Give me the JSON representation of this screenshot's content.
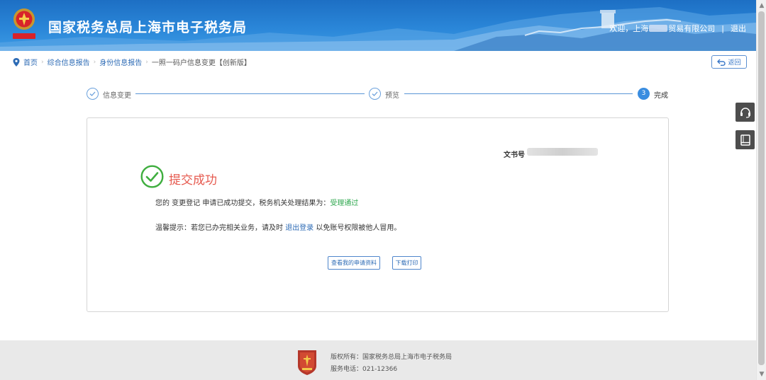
{
  "header": {
    "emblem_text": "中国税务",
    "site_title": "国家税务总局上海市电子税务局",
    "welcome_prefix": "欢迎，上海",
    "company_suffix": "贸易有限公司",
    "separator": "|",
    "logout_label": "退出"
  },
  "breadcrumb": {
    "items": [
      "首页",
      "综合信息报告",
      "身份信息报告",
      "一照一码户信息变更【创新版】"
    ],
    "return_label": "返回"
  },
  "steps": [
    {
      "label": "信息变更",
      "state": "done"
    },
    {
      "label": "预览",
      "state": "done"
    },
    {
      "number": "3",
      "label": "完成",
      "state": "current"
    }
  ],
  "result": {
    "doc_no_label": "文书号",
    "title": "提交成功",
    "message_prefix": "您的 变更登记 申请已成功提交，税务机关处理结果为：",
    "status": "受理通过",
    "tip_prefix": "温馨提示：若您已办完相关业务，请及时 ",
    "tip_link": "退出登录",
    "tip_suffix": " 以免账号权限被他人冒用。",
    "view_button": "查看我的申请资料",
    "download_button": "下载打印"
  },
  "side_tools": {
    "icons": [
      "headset-icon",
      "manual-book-icon"
    ]
  },
  "footer": {
    "copyright": "版权所有：国家税务总局上海市电子税务局",
    "hotline": "服务电话：021-12366"
  },
  "colors": {
    "header_blue": "#2a86d8",
    "success_green": "#3fae3f",
    "title_red": "#e65a4f",
    "link_blue": "#2d6bb5",
    "status_green": "#2fa84f"
  }
}
